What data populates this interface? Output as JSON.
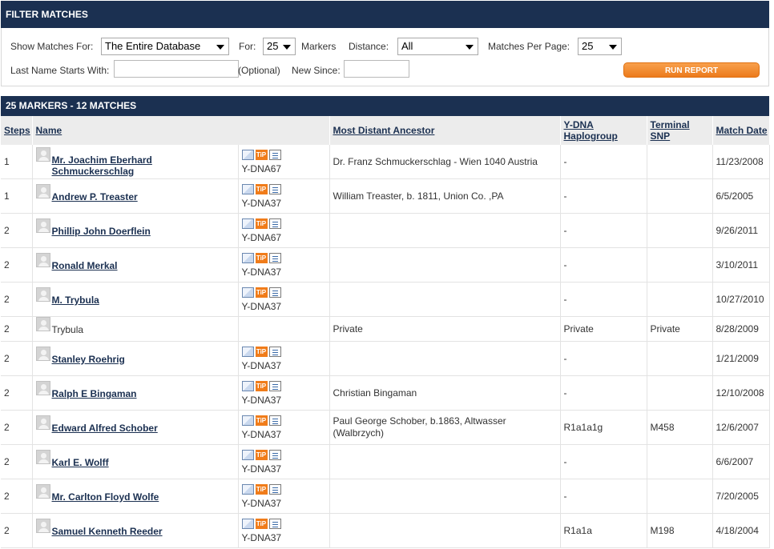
{
  "filter": {
    "title": "FILTER MATCHES",
    "show_matches_label": "Show Matches For:",
    "show_matches_value": "The Entire Database",
    "for_label": "For:",
    "for_value": "25",
    "markers_label": "Markers",
    "distance_label": "Distance:",
    "distance_value": "All",
    "per_page_label": "Matches Per Page:",
    "per_page_value": "25",
    "last_name_label": "Last Name Starts With:",
    "last_name_value": "",
    "optional_label": "(Optional)",
    "new_since_label": "New Since:",
    "new_since_value": "",
    "run_report_label": "RUN REPORT"
  },
  "results": {
    "title": "25 MARKERS - 12 MATCHES",
    "columns": {
      "steps": "Steps",
      "name": "Name",
      "ancestor": "Most Distant Ancestor",
      "haplogroup_1": "Y-DNA",
      "haplogroup_2": "Haplogroup",
      "snp_1": "Terminal",
      "snp_2": "SNP",
      "date": "Match Date"
    },
    "trip_label": "TiP",
    "rows": [
      {
        "steps": "1",
        "name": "Mr. Joachim Eberhard Schmuckerschlag",
        "test": "Y-DNA67",
        "ancestor": "Dr. Franz Schmuckerschlag - Wien 1040 Austria",
        "haplogroup": "-",
        "snp": "",
        "date": "11/23/2008"
      },
      {
        "steps": "1",
        "name": "Andrew P. Treaster",
        "test": "Y-DNA37",
        "ancestor": "William Treaster, b. 1811, Union Co. ,PA",
        "haplogroup": "-",
        "snp": "",
        "date": "6/5/2005"
      },
      {
        "steps": "2",
        "name": "Phillip John Doerflein",
        "test": "Y-DNA67",
        "ancestor": "",
        "haplogroup": "-",
        "snp": "",
        "date": "9/26/2011"
      },
      {
        "steps": "2",
        "name": "Ronald Merkal",
        "test": "Y-DNA37",
        "ancestor": "",
        "haplogroup": "-",
        "snp": "",
        "date": "3/10/2011"
      },
      {
        "steps": "2",
        "name": "M. Trybula",
        "test": "Y-DNA37",
        "ancestor": "",
        "haplogroup": "-",
        "snp": "",
        "date": "10/27/2010"
      },
      {
        "steps": "2",
        "name": "Trybula",
        "test": "",
        "ancestor": "Private",
        "haplogroup": "Private",
        "snp": "Private",
        "date": "8/28/2009"
      },
      {
        "steps": "2",
        "name": "Stanley Roehrig",
        "test": "Y-DNA37",
        "ancestor": "",
        "haplogroup": "-",
        "snp": "",
        "date": "1/21/2009"
      },
      {
        "steps": "2",
        "name": "Ralph E Bingaman",
        "test": "Y-DNA37",
        "ancestor": "Christian Bingaman",
        "haplogroup": "-",
        "snp": "",
        "date": "12/10/2008"
      },
      {
        "steps": "2",
        "name": "Edward Alfred Schober",
        "test": "Y-DNA37",
        "ancestor": "Paul George Schober, b.1863, Altwasser (Walbrzych)",
        "haplogroup": "R1a1a1g",
        "snp": "M458",
        "date": "12/6/2007"
      },
      {
        "steps": "2",
        "name": "Karl E. Wolff",
        "test": "Y-DNA37",
        "ancestor": "",
        "haplogroup": "-",
        "snp": "",
        "date": "6/6/2007"
      },
      {
        "steps": "2",
        "name": "Mr. Carlton Floyd Wolfe",
        "test": "Y-DNA37",
        "ancestor": "",
        "haplogroup": "-",
        "snp": "",
        "date": "7/20/2005"
      },
      {
        "steps": "2",
        "name": "Samuel Kenneth Reeder",
        "test": "Y-DNA37",
        "ancestor": "",
        "haplogroup": "R1a1a",
        "snp": "M198",
        "date": "4/18/2004"
      }
    ]
  }
}
